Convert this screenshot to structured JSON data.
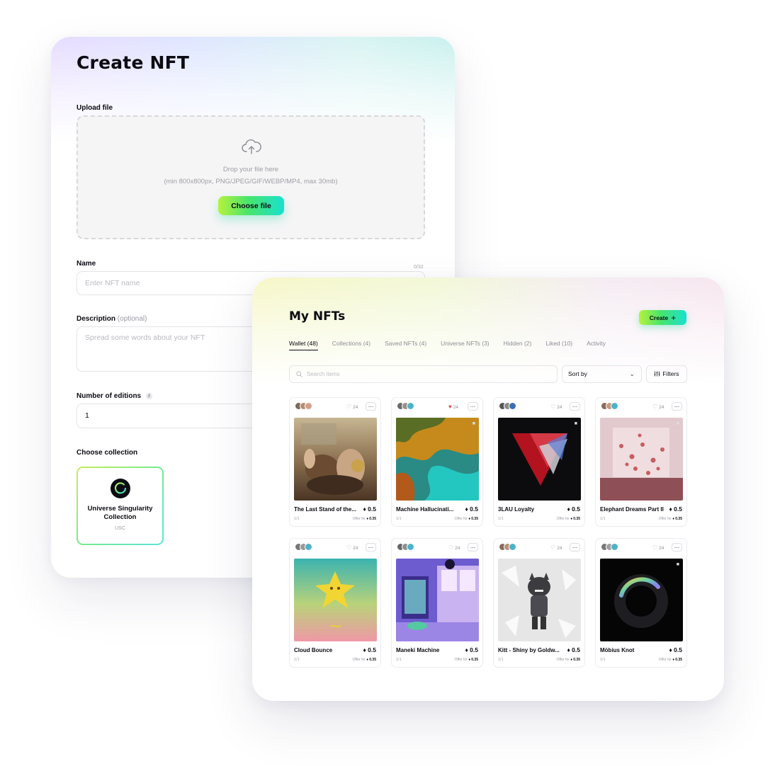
{
  "create_form": {
    "title": "Create NFT",
    "upload_label": "Upload file",
    "drop_text": "Drop your file here",
    "drop_hint": "(min 800x800px, PNG/JPEG/GIF/WEBP/MP4, max 30mb)",
    "choose_file_label": "Choose file",
    "name_label": "Name",
    "name_counter": "0/32",
    "name_placeholder": "Enter NFT name",
    "description_label": "Description",
    "description_optional": "(optional)",
    "description_placeholder": "Spread some words about your NFT",
    "editions_label": "Number of editions",
    "editions_info_icon": "i",
    "editions_value": "1",
    "collection_label": "Choose collection",
    "collection": {
      "name": "Universe Singularity Collection",
      "symbol": "USC"
    }
  },
  "my_nfts": {
    "title": "My NFTs",
    "create_button": "Create",
    "create_icon": "+",
    "tabs": [
      {
        "label": "Wallet (48)",
        "active": true
      },
      {
        "label": "Collections (4)",
        "active": false
      },
      {
        "label": "Saved NFTs (4)",
        "active": false
      },
      {
        "label": "Universe NFTs (3)",
        "active": false
      },
      {
        "label": "Hidden (2)",
        "active": false
      },
      {
        "label": "Liked (10)",
        "active": false
      },
      {
        "label": "Activity",
        "active": false
      }
    ],
    "search_placeholder": "Search items",
    "sort_label": "Sort by",
    "filters_label": "Filters",
    "offer_label": "Offer for",
    "cards": [
      {
        "name": "The Last Stand of the...",
        "likes": "24",
        "liked": false,
        "price": "0.5",
        "editions": "1/1",
        "offer": "0.35",
        "art": "battle",
        "video": false
      },
      {
        "name": "Machine Hallucinati...",
        "likes": "24",
        "liked": true,
        "price": "0.5",
        "editions": "1/1",
        "offer": "0.35",
        "art": "machine",
        "video": true
      },
      {
        "name": "3LAU Loyalty",
        "likes": "24",
        "liked": false,
        "price": "0.5",
        "editions": "1/1",
        "offer": "0.35",
        "art": "triangle",
        "video": true
      },
      {
        "name": "Elephant Dreams Part II",
        "likes": "24",
        "liked": false,
        "price": "0.5",
        "editions": "1/1",
        "offer": "0.35",
        "art": "room",
        "video": true
      },
      {
        "name": "Cloud Bounce",
        "likes": "24",
        "liked": false,
        "price": "0.5",
        "editions": "1/1",
        "offer": "0.35",
        "art": "star",
        "video": false
      },
      {
        "name": "Maneki Machine",
        "likes": "24",
        "liked": false,
        "price": "0.5",
        "editions": "1/1",
        "offer": "0.35",
        "art": "anime",
        "video": false
      },
      {
        "name": "Kitt - Shiny by Goldw...",
        "likes": "24",
        "liked": false,
        "price": "0.5",
        "editions": "1/1",
        "offer": "0.35",
        "art": "crystal",
        "video": false
      },
      {
        "name": "Möbius Knot",
        "likes": "24",
        "liked": false,
        "price": "0.5",
        "editions": "1/1",
        "offer": "0.35",
        "art": "ring",
        "video": true
      }
    ]
  },
  "colors": {
    "accent_gradient_start": "#b6f23c",
    "accent_gradient_end": "#19e0d0",
    "liked_heart": "#ef3e4e"
  }
}
